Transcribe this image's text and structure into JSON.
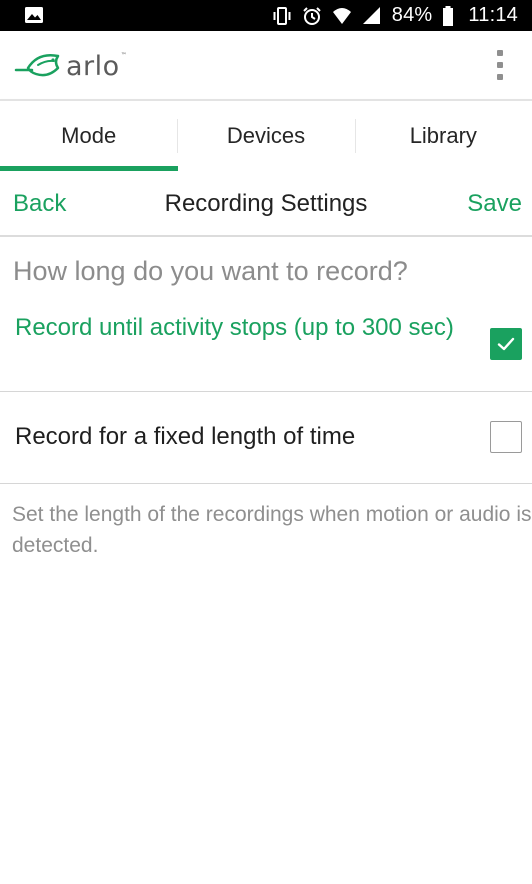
{
  "status_bar": {
    "battery_percent": "84%",
    "time": "11:14",
    "icons": [
      "image-icon",
      "vibrate-icon",
      "alarm-icon",
      "wifi-icon",
      "signal-icon",
      "battery-icon"
    ]
  },
  "app_header": {
    "logo_text": "arlo",
    "logo_tm": "™",
    "brand_color": "#1aa15f",
    "menu_icon": "kebab-menu-icon"
  },
  "tabs": [
    {
      "label": "Mode",
      "active": true
    },
    {
      "label": "Devices",
      "active": false
    },
    {
      "label": "Library",
      "active": false
    }
  ],
  "sub_header": {
    "back_label": "Back",
    "title": "Recording Settings",
    "save_label": "Save"
  },
  "question": "How long do you want to record?",
  "options": [
    {
      "label": "Record until activity stops (up to 300 sec)",
      "checked": true
    },
    {
      "label": "Record for a fixed length of time",
      "checked": false
    }
  ],
  "help_text": "Set the length of the recordings when motion or audio is detected."
}
